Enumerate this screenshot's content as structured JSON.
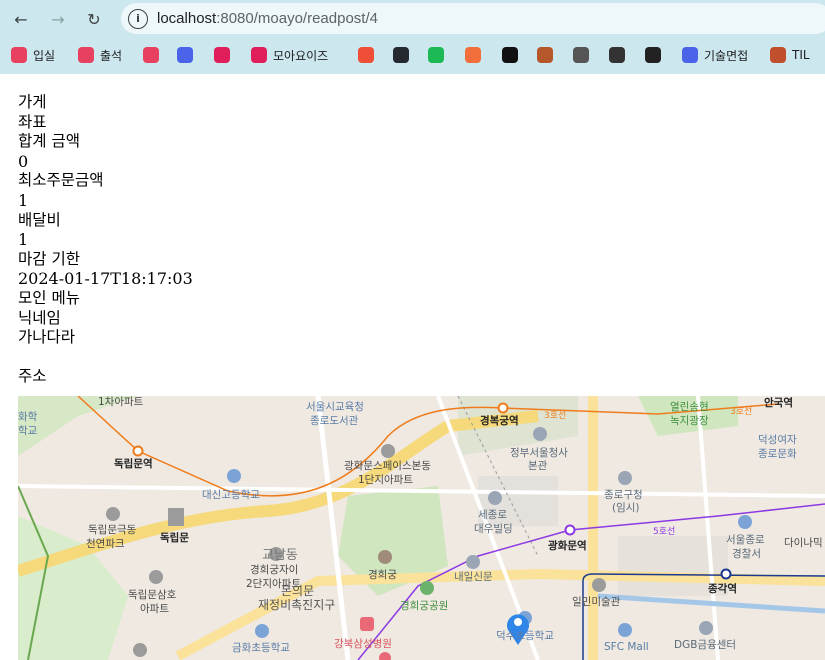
{
  "browser": {
    "url_host": "localhost",
    "url_path": ":8080/moayo/readpost/4",
    "bookmarks": [
      {
        "label": "입실",
        "icon": "heart-code-icon",
        "color": "#e8415f"
      },
      {
        "label": "출석",
        "icon": "heart-code-icon",
        "color": "#e8415f"
      },
      {
        "label": "",
        "icon": "heart-code-icon",
        "color": "#e8415f"
      },
      {
        "label": "",
        "icon": "zoom-icon",
        "color": "#4a63e8"
      },
      {
        "label": "",
        "icon": "slack-icon",
        "color": "#e01e5a"
      },
      {
        "label": "모아요이즈",
        "icon": "slack-icon",
        "color": "#e01e5a"
      },
      {
        "label": "",
        "icon": "brand-icon",
        "color": "#ef4f37"
      },
      {
        "label": "",
        "icon": "github-icon",
        "color": "#24292f"
      },
      {
        "label": "",
        "icon": "spotify-icon",
        "color": "#1db954"
      },
      {
        "label": "",
        "icon": "fire-icon",
        "color": "#f26f3b"
      },
      {
        "label": "",
        "icon": "notion-icon",
        "color": "#111111"
      },
      {
        "label": "",
        "icon": "briefcase-icon",
        "color": "#b5572a"
      },
      {
        "label": "",
        "icon": "pattern-icon",
        "color": "#555555"
      },
      {
        "label": "",
        "icon": "checkered-flag-icon",
        "color": "#333333"
      },
      {
        "label": "",
        "icon": "send-icon",
        "color": "#222222"
      },
      {
        "label": "기술면접",
        "icon": "folder-dots-icon",
        "color": "#4a63e8"
      },
      {
        "label": "TIL",
        "icon": "bridge-icon",
        "color": "#c0502d"
      }
    ]
  },
  "post": {
    "store_label": "가게",
    "seat_label": "좌표",
    "total_label": "합계 금액",
    "total_value": "0",
    "min_order_label": "최소주문금액",
    "min_order_value": "1",
    "delivery_label": "배달비",
    "delivery_value": "1",
    "deadline_label": "마감 기한",
    "deadline_value": "2024-01-17T18:17:03",
    "menu_label": "모인 메뉴",
    "nickname_label": "닉네임",
    "nickname_value": "가나다라",
    "address_label": "주소"
  },
  "map": {
    "labels": {
      "apt1": "1차아파트",
      "school_office": "서울시교육청",
      "library": "종로도서관",
      "gyeongbokgung": "경복궁역",
      "line3a": "3호선",
      "line3b": "3호선",
      "songhyeon": "열린송현",
      "songhyeon2": "녹지광장",
      "anguk": "안국역",
      "deokseong": "덕성여자",
      "deokseong2": "종로문화",
      "dongnimmun_stn": "독립문역",
      "gwanghwamun_space": "광화문스페이스본동",
      "gwanghwamun_space2": "1단지아파트",
      "govt_complex": "정부서울청사",
      "govt_complex2": "본관",
      "daeshin": "대신고등학교",
      "jongno_office": "종로구청",
      "jongno_office2": "(임시)",
      "dongnimmun_geuk": "독립문극동",
      "dongnimmun_geuk2": "천연파크",
      "dongnimmun": "독립문",
      "gyohak": "교남동",
      "sejongro": "세종로",
      "sejongro2": "대우빌딩",
      "gwanghwamun": "광화문역",
      "line5": "5호선",
      "seoul_jongno": "서울종로",
      "seoul_jongno2": "경찰서",
      "diamond": "다이나믹",
      "gyeonghuigung_apt": "경희궁자이",
      "gyeonghuigung_apt2": "2단지아파트",
      "donuimun": "돈의문",
      "jaejeong": "재정비촉진지구",
      "gyeonghuigung": "경희궁",
      "naeil": "내일신문",
      "jonggak": "종각역",
      "dongnimmun_samho": "독립문삼호",
      "dongnimmun_samho2": "아파트",
      "gyeonghuigung_park": "경희궁공원",
      "ilmin": "일민미술관",
      "kangbuk": "강북삼성병원",
      "geumhwa": "금화초등학교",
      "deoksu": "덕수초등학교",
      "sfc": "SFC Mall",
      "dgb": "DGB금융센터",
      "line_edge": "화학",
      "line_edge2": "학교"
    }
  }
}
